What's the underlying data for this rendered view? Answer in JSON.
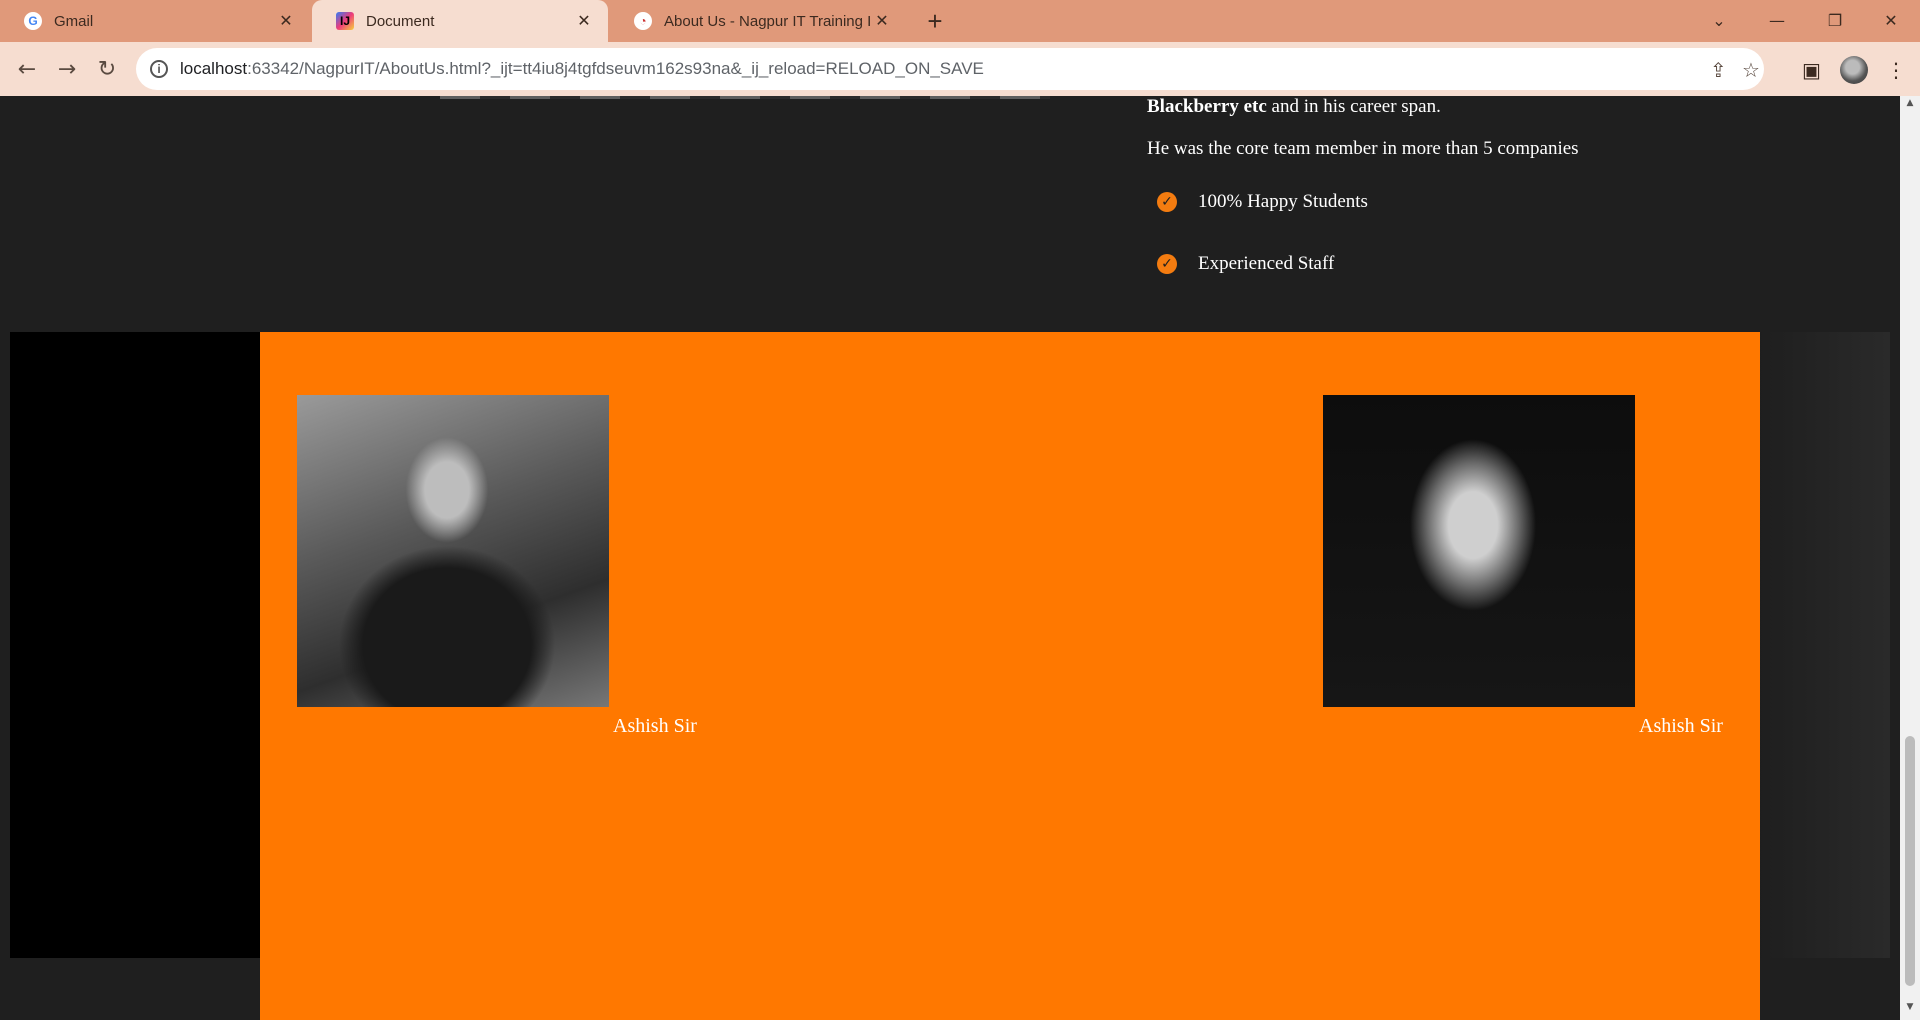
{
  "browser": {
    "tabs": [
      {
        "title": "Gmail",
        "icon": "google-g-icon",
        "active": false
      },
      {
        "title": "Document",
        "icon": "intellij-icon",
        "active": true
      },
      {
        "title": "About Us - Nagpur IT Training In",
        "icon": "site-favicon",
        "active": false
      }
    ],
    "url_host": "localhost",
    "url_rest": ":63342/NagpurIT/AboutUs.html?_ijt=tt4iu8j4tgfdseuvm162s93na&_ij_reload=RELOAD_ON_SAVE"
  },
  "about": {
    "line1_bold": "Blackberry etc",
    "line1_rest": " and in his career span.",
    "line2": "He was the core team member in more than 5 companies",
    "features": [
      "100% Happy Students",
      "Experienced Staff"
    ]
  },
  "team": {
    "members": [
      {
        "name": "Ashish Sir"
      },
      {
        "name": "Ashish Sir"
      }
    ]
  },
  "colors": {
    "accent": "#ff7800",
    "page_bg": "#1f1f1f",
    "tab_bar": "#e0997a"
  }
}
